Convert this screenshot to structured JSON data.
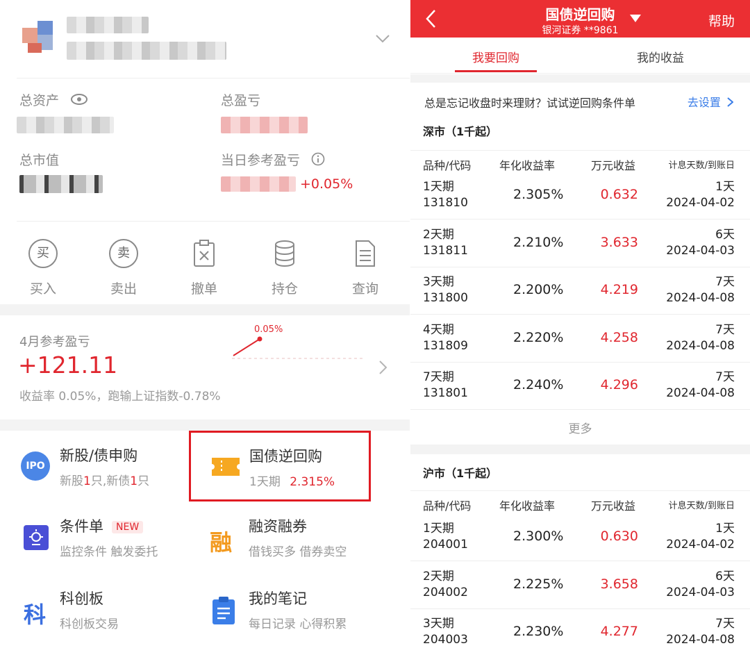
{
  "left": {
    "assets": {
      "total_assets_label": "总资产",
      "total_pl_label": "总盈亏",
      "market_value_label": "总市值",
      "daily_ref_pl_label": "当日参考盈亏",
      "daily_ref_pl_pct": "+0.05%"
    },
    "actions": [
      {
        "label": "买入",
        "glyph": "买"
      },
      {
        "label": "卖出",
        "glyph": "卖"
      },
      {
        "label": "撤单"
      },
      {
        "label": "持仓"
      },
      {
        "label": "查询"
      }
    ],
    "monthly": {
      "title": "4月参考盈亏",
      "value": "+121.11",
      "desc": "收益率 0.05%，跑输上证指数-0.78%",
      "spark_label": "0.05%"
    },
    "features": {
      "ipo": {
        "icon_text": "IPO",
        "title": "新股/债申购",
        "sub_a": "新股",
        "sub_n1": "1",
        "sub_b": "只,新债",
        "sub_n2": "1",
        "sub_c": "只"
      },
      "repo": {
        "title": "国债逆回购",
        "sub_term": "1天期",
        "sub_rate": "2.315%"
      },
      "cond": {
        "title": "条件单",
        "badge": "NEW",
        "sub": "监控条件 触发委托"
      },
      "margin": {
        "icon_text": "融",
        "title": "融资融券",
        "sub": "借钱买多 借券卖空"
      },
      "star": {
        "icon_text": "科",
        "title": "科创板",
        "sub": "科创板交易"
      },
      "notes": {
        "title": "我的笔记",
        "sub": "每日记录 心得积累"
      }
    }
  },
  "right": {
    "header": {
      "title": "国债逆回购",
      "subtitle": "银河证券 **9861",
      "help": "帮助"
    },
    "tabs": [
      "我要回购",
      "我的收益"
    ],
    "banner": {
      "text": "总是忘记收盘时来理财？试试逆回购条件单",
      "link": "去设置"
    },
    "columns": [
      "品种/代码",
      "年化收益率",
      "万元收益",
      "计息天数/到账日"
    ],
    "more": "更多",
    "sz": {
      "title": "深市（1千起）",
      "rows": [
        {
          "term": "1天期",
          "code": "131810",
          "rate": "2.305%",
          "income": "0.632",
          "days": "1天",
          "date": "2024-04-02"
        },
        {
          "term": "2天期",
          "code": "131811",
          "rate": "2.210%",
          "income": "3.633",
          "days": "6天",
          "date": "2024-04-03"
        },
        {
          "term": "3天期",
          "code": "131800",
          "rate": "2.200%",
          "income": "4.219",
          "days": "7天",
          "date": "2024-04-08"
        },
        {
          "term": "4天期",
          "code": "131809",
          "rate": "2.220%",
          "income": "4.258",
          "days": "7天",
          "date": "2024-04-08"
        },
        {
          "term": "7天期",
          "code": "131801",
          "rate": "2.240%",
          "income": "4.296",
          "days": "7天",
          "date": "2024-04-08"
        }
      ]
    },
    "sh": {
      "title": "沪市（1千起）",
      "rows": [
        {
          "term": "1天期",
          "code": "204001",
          "rate": "2.300%",
          "income": "0.630",
          "days": "1天",
          "date": "2024-04-02"
        },
        {
          "term": "2天期",
          "code": "204002",
          "rate": "2.225%",
          "income": "3.658",
          "days": "6天",
          "date": "2024-04-03"
        },
        {
          "term": "3天期",
          "code": "204003",
          "rate": "2.230%",
          "income": "4.277",
          "days": "7天",
          "date": "2024-04-08"
        }
      ]
    }
  }
}
